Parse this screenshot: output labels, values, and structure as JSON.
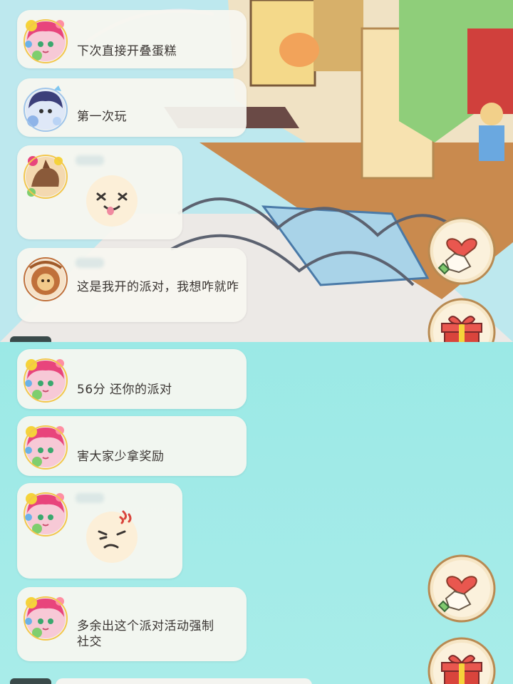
{
  "colors": {
    "bubble_bg": "#f8f6f0",
    "text": "#3a3532",
    "bottom_bg": "#a2eae7",
    "floor_wood": "#c98a4e",
    "heart": "#e9574f",
    "gift_red": "#d9443c"
  },
  "top_panel": {
    "messages": [
      {
        "avatar": "pink-hair-girl-avatar",
        "text": "下次直接开叠蛋糕"
      },
      {
        "avatar": "blue-hair-boy-avatar",
        "text": "第一次玩"
      },
      {
        "avatar": "fox-avatar",
        "sticker": "dizzy-face-sticker"
      },
      {
        "avatar": "lion-avatar",
        "text": "这是我开的派对，我想咋就咋"
      }
    ],
    "buttons": [
      {
        "icon": "heart-hand-icon",
        "label": "like"
      },
      {
        "icon": "gift-icon",
        "label": "gift"
      }
    ]
  },
  "bottom_panel": {
    "messages": [
      {
        "avatar": "pink-hair-girl-avatar",
        "text": "56分 还你的派对"
      },
      {
        "avatar": "pink-hair-girl-avatar",
        "text": "害大家少拿奖励"
      },
      {
        "avatar": "pink-hair-girl-avatar",
        "sticker": "angry-face-sticker"
      },
      {
        "avatar": "pink-hair-girl-avatar",
        "text": "多余出这个派对活动强制社交"
      }
    ],
    "buttons": [
      {
        "icon": "heart-hand-icon",
        "label": "like"
      },
      {
        "icon": "gift-icon",
        "label": "gift"
      }
    ]
  }
}
